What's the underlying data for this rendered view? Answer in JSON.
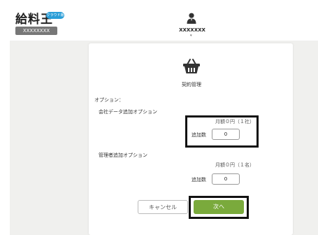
{
  "header": {
    "logo_title": "給料王",
    "cloud_badge": "クラウド版",
    "company_name": "XXXXXXXX",
    "user_name": "XXXXXXX",
    "user_caret": "▾"
  },
  "panel": {
    "title": "契約管理",
    "options_label": "オプション：",
    "sections": [
      {
        "title": "会社データ追加オプション",
        "price": "月額０円（１社）",
        "qty_label": "追加数",
        "qty_value": "0"
      },
      {
        "title": "管理者追加オプション",
        "price": "月額０円（１名）",
        "qty_label": "追加数",
        "qty_value": "0"
      }
    ]
  },
  "buttons": {
    "cancel": "キャンセル",
    "next": "次へ"
  },
  "colors": {
    "badge": "#2a9ed8",
    "next_button": "#7aaa3c",
    "background": "#f0f0ee",
    "highlight": "#111111"
  },
  "icons": [
    "user-icon",
    "shopping-basket-icon"
  ]
}
